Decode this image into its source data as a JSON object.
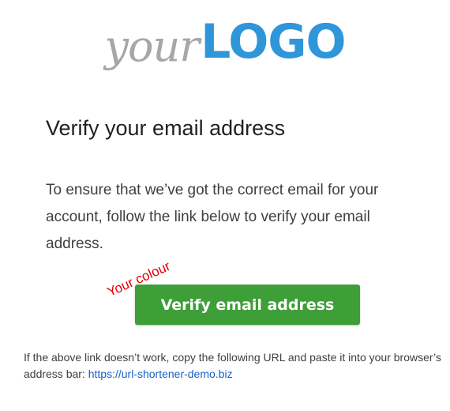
{
  "logo": {
    "prefix": "your",
    "mark": "LOGO",
    "prefix_color": "#a7a7a7",
    "mark_color": "#2f96d9"
  },
  "email": {
    "heading": "Verify your email address",
    "body": "To ensure that we’ve got the correct email for your account, follow the link below to verify your email address.",
    "button_label": "Verify email address",
    "button_color": "#3e9e38",
    "annotation": "Your colour",
    "annotation_color": "#e20000",
    "fallback_text": "If the above link doesn’t work, copy the following URL and paste it into your browser’s address bar: ",
    "fallback_url": "https://url-shortener-demo.biz",
    "link_color": "#1a5fc8"
  }
}
